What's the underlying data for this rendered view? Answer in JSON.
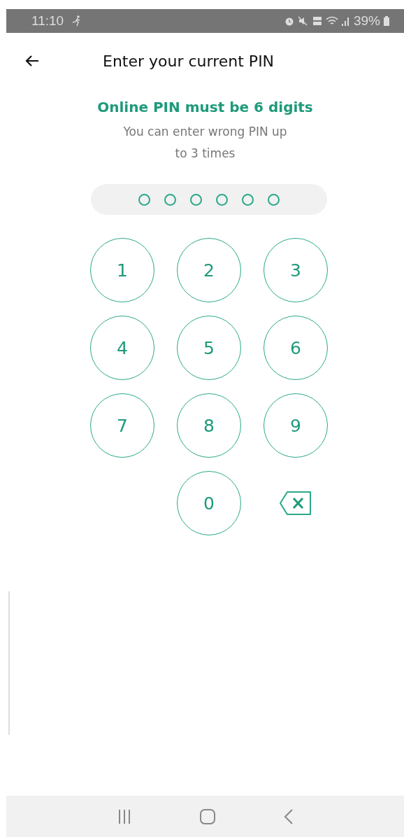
{
  "status_bar": {
    "time": "11:10",
    "battery": "39%"
  },
  "header": {
    "title": "Enter your current PIN"
  },
  "message": {
    "title": "Online PIN must be 6 digits",
    "subtitle": "You can enter wrong PIN up to 3 times"
  },
  "pin_dots": [
    {
      "filled": false
    },
    {
      "filled": false
    },
    {
      "filled": false
    },
    {
      "filled": false
    },
    {
      "filled": false
    },
    {
      "filled": false
    }
  ],
  "keypad": [
    {
      "kind": "digit",
      "label": "1"
    },
    {
      "kind": "digit",
      "label": "2"
    },
    {
      "kind": "digit",
      "label": "3"
    },
    {
      "kind": "digit",
      "label": "4"
    },
    {
      "kind": "digit",
      "label": "5"
    },
    {
      "kind": "digit",
      "label": "6"
    },
    {
      "kind": "digit",
      "label": "7"
    },
    {
      "kind": "digit",
      "label": "8"
    },
    {
      "kind": "digit",
      "label": "9"
    },
    {
      "kind": "blank"
    },
    {
      "kind": "digit",
      "label": "0"
    },
    {
      "kind": "delete"
    }
  ]
}
